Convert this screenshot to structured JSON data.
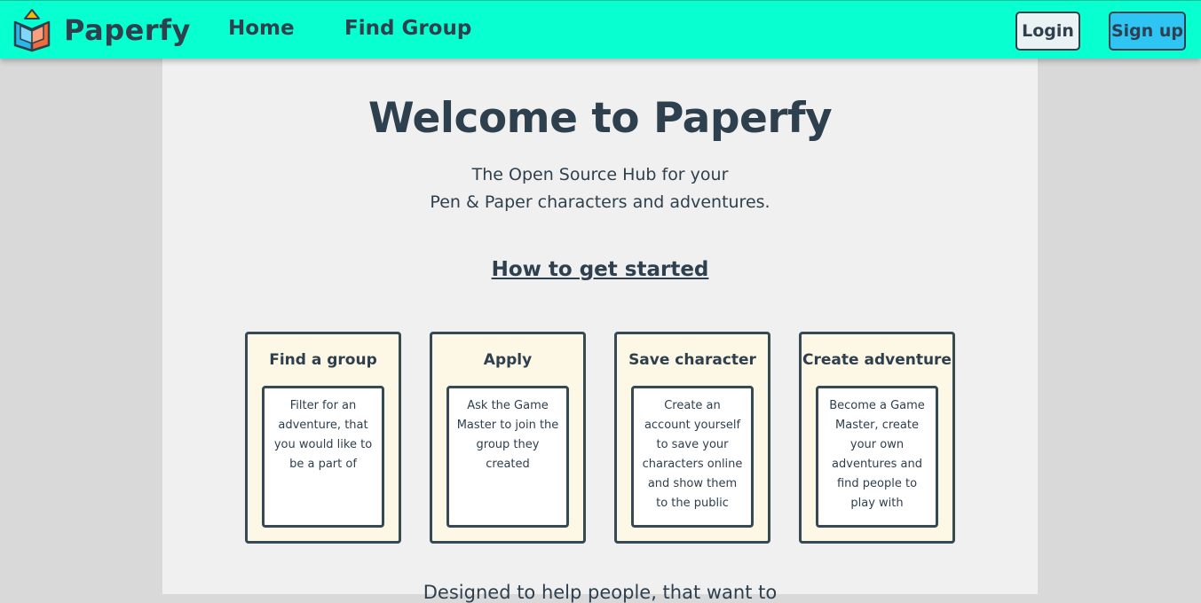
{
  "navbar": {
    "brand": "Paperfy",
    "links": [
      {
        "label": "Home"
      },
      {
        "label": "Find Group"
      }
    ],
    "login_label": "Login",
    "signup_label": "Sign up"
  },
  "hero": {
    "title": "Welcome to Paperfy",
    "subtitle_line1": "The Open Source Hub for your",
    "subtitle_line2": "Pen & Paper characters and adventures.",
    "how_link": "How to get started"
  },
  "cards": [
    {
      "title": "Find a group",
      "text": "Filter for an adventure, that you would like to be a part of"
    },
    {
      "title": "Apply",
      "text": "Ask the Game Master to join the group they created"
    },
    {
      "title": "Save character",
      "text": "Create an account yourself to save your characters online and show them to the public"
    },
    {
      "title": "Create adventure",
      "text": "Become a Game Master, create your own adventures and find people to play with"
    }
  ],
  "footer_text": "Designed to help people, that want to",
  "colors": {
    "navbar": "#08ffd0",
    "signup": "#2ec4f4",
    "text": "#2e3f4d",
    "card": "#fdf7e6"
  }
}
